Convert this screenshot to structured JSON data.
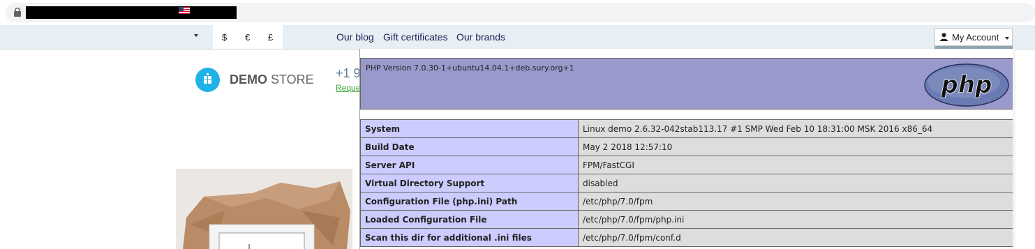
{
  "browser": {
    "lock_icon": "lock-icon"
  },
  "topnav": {
    "language_flag": "us-flag-icon",
    "currencies": [
      "$",
      "€",
      "£"
    ],
    "links": [
      "Our blog",
      "Gift certificates",
      "Our brands"
    ],
    "account_label": "My Account"
  },
  "header": {
    "logo_bold": "DEMO",
    "logo_light": " STORE",
    "phone": "+1 9",
    "request_link": "Reque"
  },
  "phpinfo": {
    "version": "PHP Version 7.0.30-1+ubuntu14.04.1+deb.sury.org+1",
    "logo_text": "php",
    "rows": [
      {
        "key": "System",
        "value": "Linux demo 2.6.32-042stab113.17 #1 SMP Wed Feb 10 18:31:00 MSK 2016 x86_64"
      },
      {
        "key": "Build Date",
        "value": "May 2 2018 12:57:10"
      },
      {
        "key": "Server API",
        "value": "FPM/FastCGI"
      },
      {
        "key": "Virtual Directory Support",
        "value": "disabled"
      },
      {
        "key": "Configuration File (php.ini) Path",
        "value": "/etc/php/7.0/fpm"
      },
      {
        "key": "Loaded Configuration File",
        "value": "/etc/php/7.0/fpm/php.ini"
      },
      {
        "key": "Scan this dir for additional .ini files",
        "value": "/etc/php/7.0/fpm/conf.d"
      }
    ]
  },
  "colors": {
    "php_header": "#9999cc",
    "php_key_cell": "#ccccff",
    "php_value_cell": "#dddddd",
    "nav_bg": "#e7eef4",
    "logo_accent": "#1fb2e8"
  }
}
